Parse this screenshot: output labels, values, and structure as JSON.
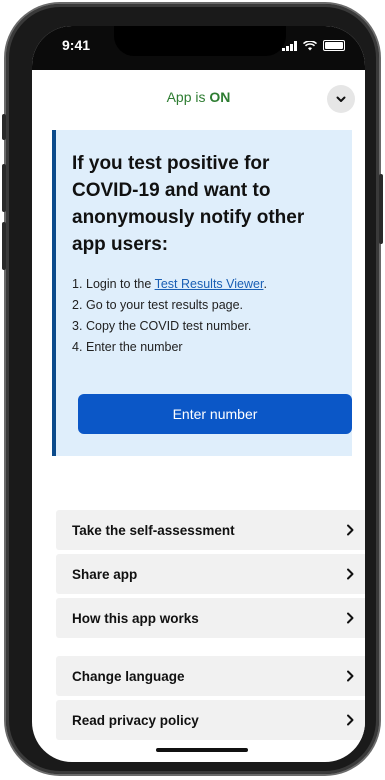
{
  "status_bar": {
    "time": "9:41"
  },
  "header": {
    "status_prefix": "App is ",
    "status_value": "ON"
  },
  "card": {
    "title": "If you test positive for COVID-19 and want to anonymously notify other app users:",
    "steps": [
      {
        "num": "1.",
        "before": "Login to the ",
        "link": "Test Results Viewer",
        "after": "."
      },
      {
        "num": "2.",
        "text": "Go to your test results page."
      },
      {
        "num": "3.",
        "text": "Copy the COVID test number."
      },
      {
        "num": "4.",
        "text": "Enter the number"
      }
    ],
    "button_label": "Enter number"
  },
  "menu_primary": [
    {
      "label": "Take the self-assessment"
    },
    {
      "label": "Share app"
    },
    {
      "label": "How this app works"
    }
  ],
  "menu_secondary": [
    {
      "label": "Change language"
    },
    {
      "label": "Read privacy policy"
    }
  ],
  "colors": {
    "accent": "#0b57c7",
    "card_bg": "#dfeefb",
    "status_on": "#2e7d32"
  }
}
